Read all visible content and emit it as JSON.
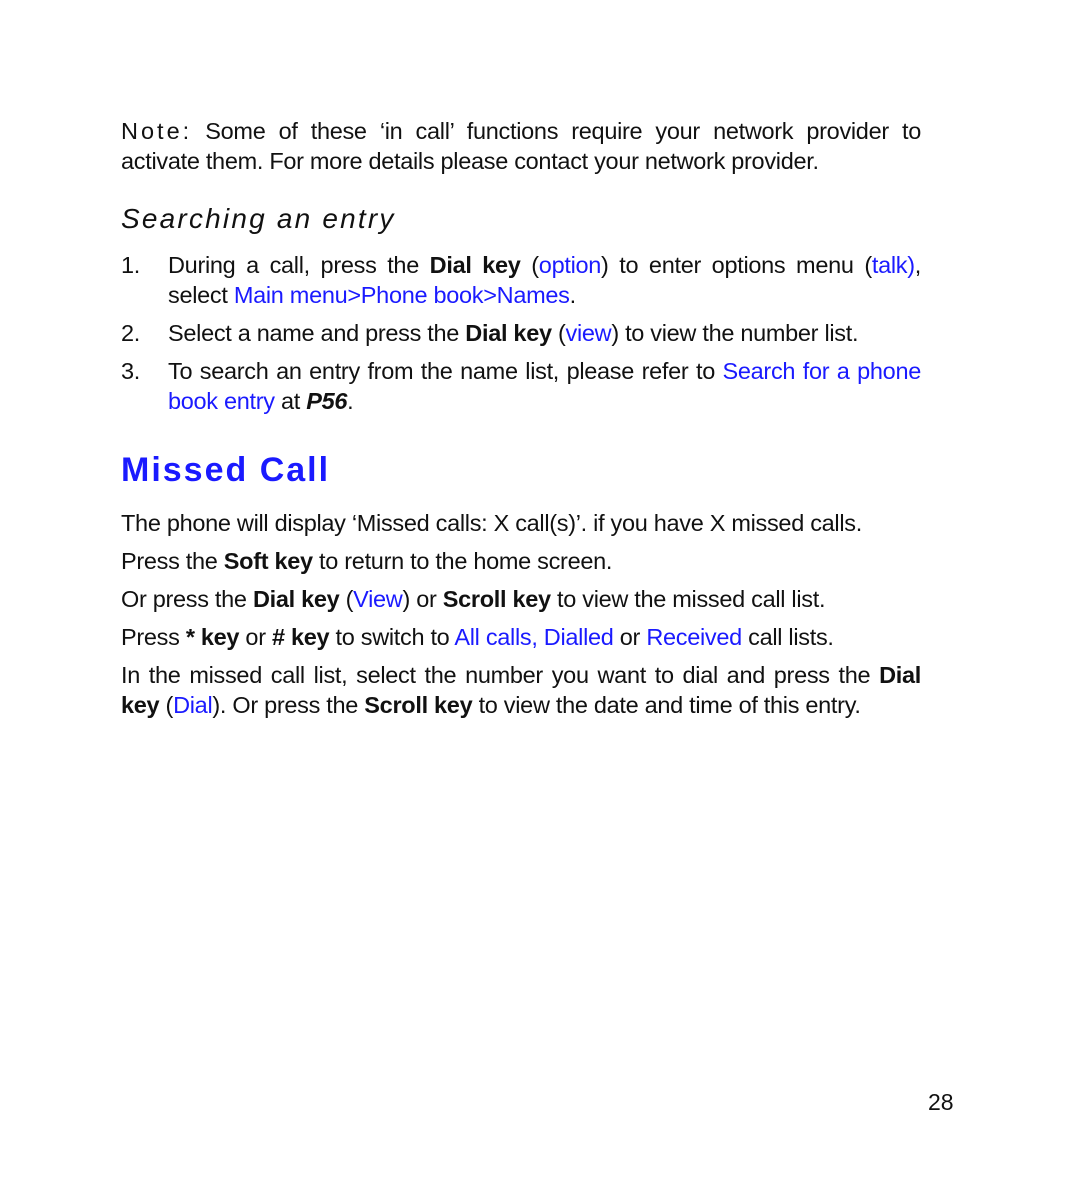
{
  "note": {
    "label": "Note:",
    "text": " Some of these ‘in call’ functions require your network provider to activate them. For more details please contact your network provider."
  },
  "searching_section": {
    "heading": "Searching an entry",
    "steps": [
      {
        "number": "1.",
        "t1": "During a call, press the ",
        "b1": "Dial key",
        "t2": " (",
        "l1": "option",
        "t3": ") to enter options menu (",
        "l2": "talk)",
        "t4": ", select ",
        "l3": "Main menu>Phone book>Names",
        "t5": "."
      },
      {
        "number": "2.",
        "t1": "Select a name and press the ",
        "b1": "Dial key",
        "t2": " (",
        "l1": "view",
        "t3": ") to view the number list."
      },
      {
        "number": "3.",
        "t1": "To search an entry from the name list, please refer to ",
        "l1": "Search for a phone book entry",
        "t2": " at ",
        "bi1": "P56",
        "t3": "."
      }
    ]
  },
  "missed_call_section": {
    "heading": "Missed Call",
    "p1": "The phone will display ‘Missed calls: X call(s)’. if you have X missed calls.",
    "p2": {
      "t1": "Press the ",
      "b1": "Soft key",
      "t2": " to return to the home screen."
    },
    "p3": {
      "t1": "Or press the ",
      "b1": "Dial key",
      "t2": " (",
      "l1": "View",
      "t3": ") or ",
      "b2": "Scroll key",
      "t4": " to view the missed call list."
    },
    "p4": {
      "t1": "Press ",
      "b1": "* key",
      "t2": " or ",
      "b2": "# key",
      "t3": " to switch to ",
      "l1": "All calls, Dialled",
      "t4": " or ",
      "l2": "Received",
      "t5": " call lists."
    },
    "p5": {
      "t1": "In the missed call list, select the number you want to dial and press the ",
      "b1": "Dial key",
      "t2": " (",
      "l1": "Dial",
      "t3": "). Or press the ",
      "b2": "Scroll key",
      "t4": " to view the date and time of this entry."
    }
  },
  "page_number": "28",
  "colors": {
    "link": "#1a1aff",
    "text": "#111111"
  }
}
